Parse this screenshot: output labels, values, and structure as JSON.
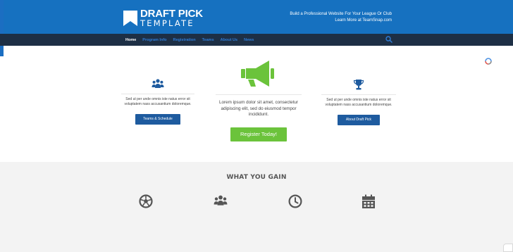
{
  "header": {
    "logo": {
      "line1": "DRAFT PICK",
      "line2": "TEMPLATE"
    },
    "tagline": {
      "line1": "Build a Professional Website For Your League Or Club",
      "line2": "Learn More at TeamSnap.com"
    },
    "colors": {
      "header_bg": "#1671c0",
      "nav_bg": "#1d2f45",
      "nav_link": "#2f7cd6"
    }
  },
  "nav": {
    "items": [
      {
        "label": "Home",
        "active": true
      },
      {
        "label": "Program Info",
        "active": false
      },
      {
        "label": "Registration",
        "active": false
      },
      {
        "label": "Teams",
        "active": false
      },
      {
        "label": "About Us",
        "active": false
      },
      {
        "label": "News",
        "active": false
      }
    ],
    "search_icon": "search-icon"
  },
  "features": {
    "left": {
      "icon": "users-icon",
      "text": "Sed ut per unde omnis iste natus error sit voluptatem nass accusantium doloremque.",
      "button": "Teams & Schedule"
    },
    "center": {
      "icon": "megaphone-icon",
      "text": "Lorem ipsum dolor sit amet, consectetur adipiscing elit, sed do eiusmod tempor incididunt.",
      "button": "Register Today!"
    },
    "right": {
      "icon": "trophy-icon",
      "text": "Sed ut per unde omnis iste natus error sit voluptatem nass accusantium doloremque.",
      "button": "About Draft Pick"
    },
    "colors": {
      "primary_button": "#1e5b9f",
      "accent_button": "#6bc33b",
      "megaphone": "#6bc33b",
      "icon_blue": "#1e5b9f"
    }
  },
  "gain": {
    "title": "WHAT YOU GAIN",
    "icons": [
      "soccer-ball-icon",
      "users-icon",
      "clock-icon",
      "calendar-icon"
    ]
  }
}
